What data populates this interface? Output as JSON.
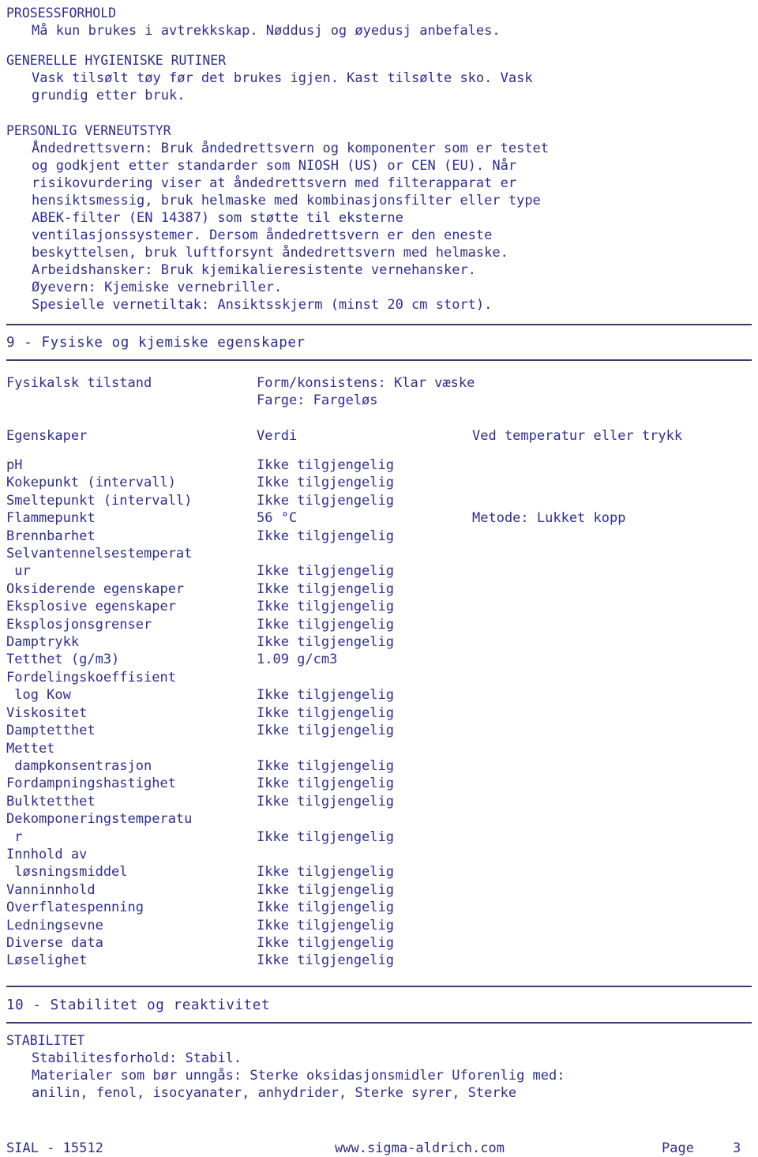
{
  "document": {
    "language": "no",
    "text_color": "#2e2e8f",
    "rule_color": "#3a3a6b",
    "background": "#ffffff"
  },
  "top_sections": [
    {
      "heading": "PROSESSFORHOLD",
      "lines": [
        "Må kun brukes i avtrekkskap. Nøddusj og øyedusj anbefales."
      ]
    },
    {
      "heading": "GENERELLE HYGIENISKE RUTINER",
      "lines": [
        "Vask tilsølt tøy før det brukes igjen. Kast tilsølte sko. Vask",
        "grundig etter bruk."
      ]
    },
    {
      "heading": "PERSONLIG VERNEUTSTYR",
      "lines": [
        "Åndedrettsvern: Bruk åndedrettsvern og komponenter som er testet",
        "og godkjent etter standarder som NIOSH (US) or CEN (EU). Når",
        "risikovurdering viser at åndedrettsvern med filterapparat er",
        "hensiktsmessig, bruk helmaske med kombinasjonsfilter eller type",
        "ABEK-filter (EN 14387) som støtte til eksterne",
        "ventilasjonssystemer. Dersom åndedrettsvern er den eneste",
        "beskyttelsen, bruk luftforsynt åndedrettsvern med helmaske.",
        "Arbeidshansker: Bruk kjemikalieresistente vernehansker.",
        "Øyevern: Kjemiske vernebriller.",
        "Spesielle vernetiltak: Ansiktsskjerm (minst 20 cm stort)."
      ]
    }
  ],
  "section9": {
    "title": "9 - Fysiske og kjemiske egenskaper",
    "physical_state": {
      "label": "Fysikalsk tilstand",
      "value_line1": "Form/konsistens: Klar væske",
      "value_line2": "Farge: Fargeløs"
    },
    "table_headers": {
      "name": "Egenskaper",
      "value": "Verdi",
      "condition": "Ved temperatur eller trykk"
    },
    "rows": [
      {
        "name": "pH",
        "value": "Ikke tilgjengelig",
        "condition": ""
      },
      {
        "name": "Kokepunkt (intervall)",
        "value": "Ikke tilgjengelig",
        "condition": ""
      },
      {
        "name": "Smeltepunkt (intervall)",
        "value": "Ikke tilgjengelig",
        "condition": ""
      },
      {
        "name": "Flammepunkt",
        "value": "56 °C",
        "condition": "Metode: Lukket kopp"
      },
      {
        "name": "Brennbarhet",
        "value": "Ikke tilgjengelig",
        "condition": ""
      },
      {
        "name": "Selvantennelsestemperat",
        "value": "",
        "condition": ""
      },
      {
        "name": " ur",
        "value": "Ikke tilgjengelig",
        "condition": ""
      },
      {
        "name": "Oksiderende egenskaper",
        "value": "Ikke tilgjengelig",
        "condition": ""
      },
      {
        "name": "Eksplosive egenskaper",
        "value": "Ikke tilgjengelig",
        "condition": ""
      },
      {
        "name": "Eksplosjonsgrenser",
        "value": "Ikke tilgjengelig",
        "condition": ""
      },
      {
        "name": "Damptrykk",
        "value": "Ikke tilgjengelig",
        "condition": ""
      },
      {
        "name": "Tetthet (g/m3)",
        "value": "1.09 g/cm3",
        "condition": ""
      },
      {
        "name": "Fordelingskoeffisient",
        "value": "",
        "condition": ""
      },
      {
        "name": " log Kow",
        "value": "Ikke tilgjengelig",
        "condition": ""
      },
      {
        "name": "Viskositet",
        "value": "Ikke tilgjengelig",
        "condition": ""
      },
      {
        "name": "Damptetthet",
        "value": "Ikke tilgjengelig",
        "condition": ""
      },
      {
        "name": "Mettet",
        "value": "",
        "condition": ""
      },
      {
        "name": " dampkonsentrasjon",
        "value": "Ikke tilgjengelig",
        "condition": ""
      },
      {
        "name": "Fordampningshastighet",
        "value": "Ikke tilgjengelig",
        "condition": ""
      },
      {
        "name": "Bulktetthet",
        "value": "Ikke tilgjengelig",
        "condition": ""
      },
      {
        "name": "Dekomponeringstemperatu",
        "value": "",
        "condition": ""
      },
      {
        "name": " r",
        "value": "Ikke tilgjengelig",
        "condition": ""
      },
      {
        "name": "Innhold av",
        "value": "",
        "condition": ""
      },
      {
        "name": " løsningsmiddel",
        "value": "Ikke tilgjengelig",
        "condition": ""
      },
      {
        "name": "Vanninnhold",
        "value": "Ikke tilgjengelig",
        "condition": ""
      },
      {
        "name": "Overflatespenning",
        "value": "Ikke tilgjengelig",
        "condition": ""
      },
      {
        "name": "Ledningsevne",
        "value": "Ikke tilgjengelig",
        "condition": ""
      },
      {
        "name": "Diverse data",
        "value": "Ikke tilgjengelig",
        "condition": ""
      },
      {
        "name": "Løselighet",
        "value": "Ikke tilgjengelig",
        "condition": ""
      }
    ]
  },
  "section10": {
    "title": "10 - Stabilitet og reaktivitet",
    "heading": "STABILITET",
    "lines": [
      "Stabilitesforhold: Stabil.",
      "Materialer som bør unngås: Sterke oksidasjonsmidler Uforenlig med:",
      "anilin, fenol, isocyanater, anhydrider, Sterke syrer, Sterke"
    ]
  },
  "footer": {
    "left": "SIAL - 15512",
    "center": "www.sigma-aldrich.com",
    "page_label": "Page",
    "page_number": "3"
  }
}
